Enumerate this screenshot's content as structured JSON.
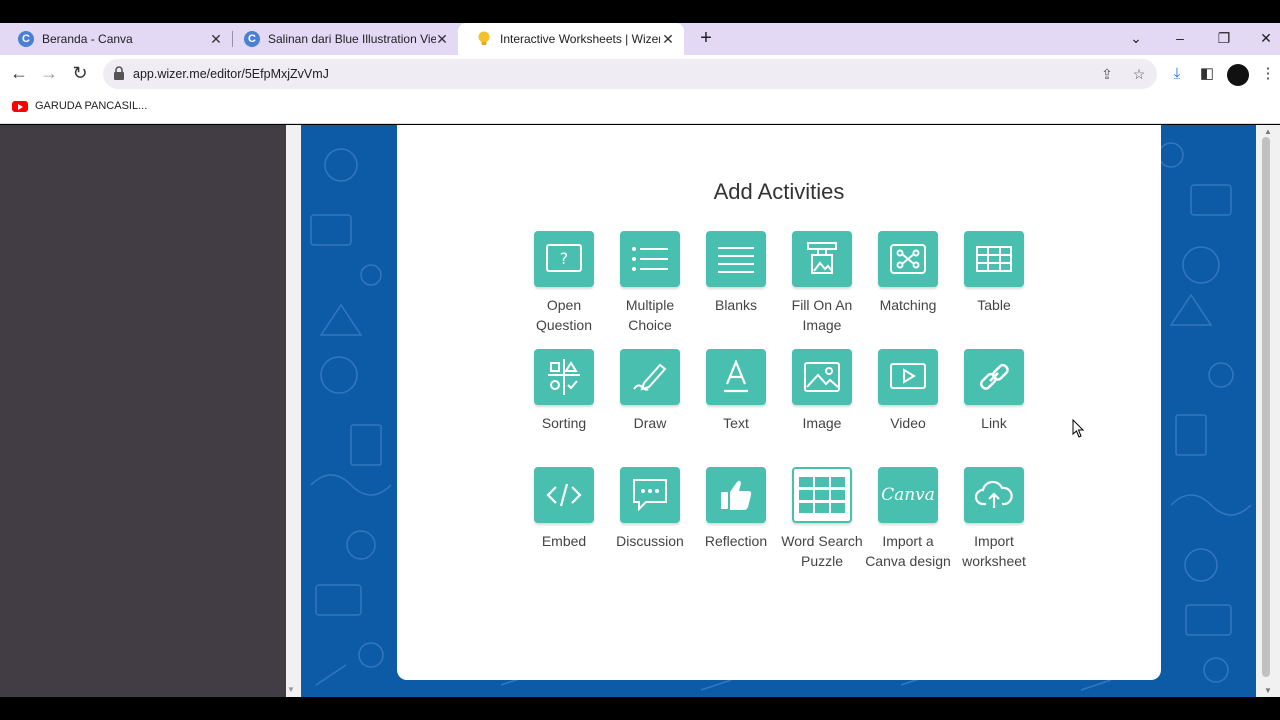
{
  "browser": {
    "tabs": [
      {
        "title": "Beranda - Canva",
        "favicon": "canva-icon",
        "color": "#4a7fd6"
      },
      {
        "title": "Salinan dari Blue Illustration View",
        "favicon": "canva-icon",
        "color": "#4a7fd6"
      },
      {
        "title": "Interactive Worksheets | Wizer.me",
        "favicon": "wizer-bulb-icon",
        "color": "#f6c02b"
      }
    ],
    "active_tab": 2,
    "url": "app.wizer.me/editor/5EfpMxjZvVmJ",
    "bookmarks": [
      {
        "label": "GARUDA PANCASIL...",
        "icon": "youtube-icon"
      }
    ]
  },
  "editor": {
    "title": "Add Activities",
    "activities": [
      {
        "label": "Open Question",
        "icon": "question-icon"
      },
      {
        "label": "Multiple Choice",
        "icon": "list-icon"
      },
      {
        "label": "Blanks",
        "icon": "lines-icon"
      },
      {
        "label": "Fill On An Image",
        "icon": "fill-image-icon"
      },
      {
        "label": "Matching",
        "icon": "matching-icon"
      },
      {
        "label": "Table",
        "icon": "table-icon"
      },
      {
        "label": "Sorting",
        "icon": "sorting-icon"
      },
      {
        "label": "Draw",
        "icon": "pencil-icon"
      },
      {
        "label": "Text",
        "icon": "text-a-icon"
      },
      {
        "label": "Image",
        "icon": "image-icon"
      },
      {
        "label": "Video",
        "icon": "video-icon"
      },
      {
        "label": "Link",
        "icon": "link-icon"
      },
      {
        "label": "Embed",
        "icon": "code-icon"
      },
      {
        "label": "Discussion",
        "icon": "chat-icon"
      },
      {
        "label": "Reflection",
        "icon": "thumbs-up-icon"
      },
      {
        "label": "Word Search Puzzle",
        "icon": "grid-icon"
      },
      {
        "label": "Import a Canva design",
        "icon": "canva-logo-icon",
        "logo_text": "Canva"
      },
      {
        "label": "Import worksheet",
        "icon": "cloud-upload-icon"
      }
    ]
  },
  "colors": {
    "tile": "#48bfaf",
    "background_pattern": "#0d5aa7",
    "left_panel": "#423d44",
    "tab_strip": "#e4d9f4"
  }
}
